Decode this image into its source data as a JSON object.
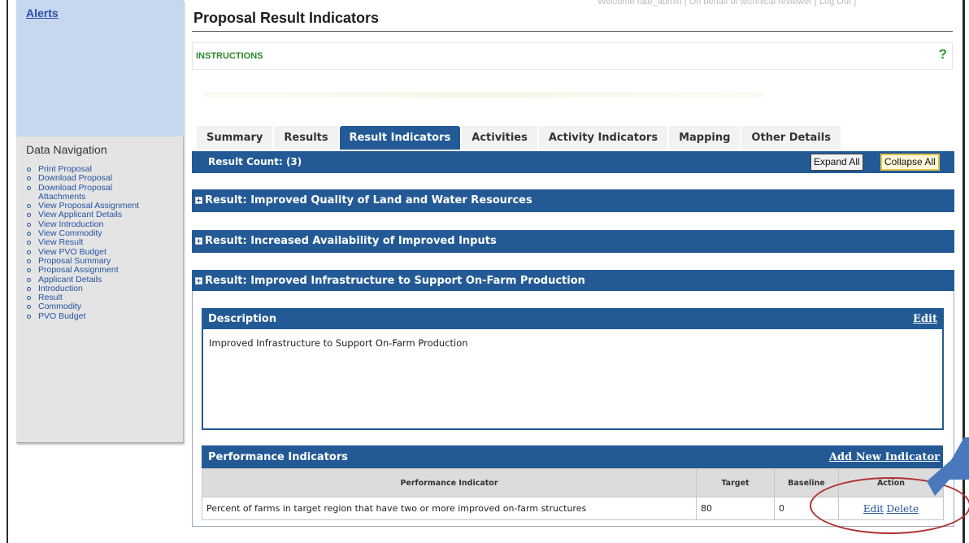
{
  "header": {
    "welcome_text": "Welcome rate_admin | On behalf of technical reviewer [ Log Out ]",
    "page_title": "Proposal Result Indicators",
    "instructions_label": "INSTRUCTIONS",
    "help_symbol": "?"
  },
  "sidebar": {
    "alerts_label": "Alerts",
    "nav_title": "Data Navigation",
    "items": [
      {
        "label": "Print Proposal"
      },
      {
        "label": "Download Proposal"
      },
      {
        "label": "Download Proposal Attachments"
      },
      {
        "label": "View Proposal Assignment"
      },
      {
        "label": "View Applicant Details"
      },
      {
        "label": "View Introduction"
      },
      {
        "label": "View Commodity"
      },
      {
        "label": "View Result"
      },
      {
        "label": "View PVO Budget"
      },
      {
        "label": "Proposal Summary"
      },
      {
        "label": "Proposal Assignment"
      },
      {
        "label": "Applicant Details"
      },
      {
        "label": "Introduction"
      },
      {
        "label": "Result"
      },
      {
        "label": "Commodity"
      },
      {
        "label": "PVO Budget"
      }
    ]
  },
  "tabs": [
    {
      "label": "Summary",
      "active": false
    },
    {
      "label": "Results",
      "active": false
    },
    {
      "label": "Result Indicators",
      "active": true
    },
    {
      "label": "Activities",
      "active": false
    },
    {
      "label": "Activity Indicators",
      "active": false
    },
    {
      "label": "Mapping",
      "active": false
    },
    {
      "label": "Other Details",
      "active": false
    }
  ],
  "results_bar": {
    "count_text": "Result Count: (3)",
    "expand_label": "Expand All",
    "collapse_label": "Collapse All"
  },
  "results": [
    {
      "label": "Result: Improved Quality of Land and Water Resources"
    },
    {
      "label": "Result: Increased Availability of Improved Inputs"
    },
    {
      "label": "Result: Improved Infrastructure to Support On-Farm Production"
    }
  ],
  "description": {
    "title": "Description",
    "edit_label": "Edit",
    "text": "Improved Infrastructure to Support On-Farm Production"
  },
  "performance": {
    "title": "Performance Indicators",
    "add_label": "Add New Indicator",
    "columns": [
      "Performance Indicator",
      "Target",
      "Baseline",
      "Action"
    ],
    "rows": [
      {
        "indicator": "Percent of farms in target region that have two or more improved on-farm structures",
        "target": "80",
        "baseline": "0",
        "edit": "Edit",
        "delete": "Delete"
      }
    ]
  },
  "colors": {
    "header_blue": "#235a96",
    "alerts_panel": "#c8d7f0",
    "annotation_red": "#b03030",
    "annotation_arrow": "#4a78bd"
  }
}
